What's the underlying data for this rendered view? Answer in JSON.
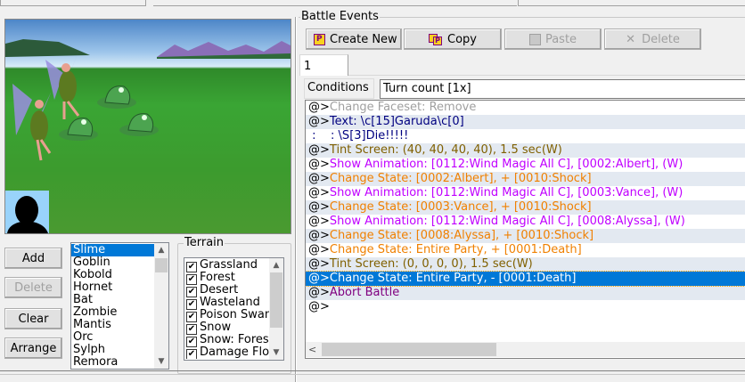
{
  "battle_events": {
    "title": "Battle Events",
    "buttons": {
      "create_new": "Create New",
      "copy": "Copy",
      "paste": "Paste",
      "delete": "Delete"
    },
    "tabs": [
      "1"
    ],
    "conditions_label": "Conditions",
    "conditions_value": "Turn count [1x]",
    "events": [
      {
        "prefix": "@>",
        "text": "Change Faceset: Remove",
        "color": "#a0a0a0"
      },
      {
        "prefix": "@>",
        "text": "Text: \\c[15]Garuda\\c[0]",
        "color": "#000080"
      },
      {
        "prefix": " :",
        "text": "    : \\S[3]Die!!!!!",
        "color": "#000080"
      },
      {
        "prefix": "@>",
        "text": "Tint Screen: (40, 40, 40, 40), 1.5 sec(W)",
        "color": "#806000"
      },
      {
        "prefix": "@>",
        "text": "Show Animation: [0112:Wind Magic All C], [0002:Albert], (W)",
        "color": "#c000ff"
      },
      {
        "prefix": "@>",
        "text": "Change State: [0002:Albert], + [0010:Shock]",
        "color": "#f08000"
      },
      {
        "prefix": "@>",
        "text": "Show Animation: [0112:Wind Magic All C], [0003:Vance], (W)",
        "color": "#c000ff"
      },
      {
        "prefix": "@>",
        "text": "Change State: [0003:Vance], + [0010:Shock]",
        "color": "#f08000"
      },
      {
        "prefix": "@>",
        "text": "Show Animation: [0112:Wind Magic All C], [0008:Alyssa], (W)",
        "color": "#c000ff"
      },
      {
        "prefix": "@>",
        "text": "Change State: [0008:Alyssa], + [0010:Shock]",
        "color": "#f08000"
      },
      {
        "prefix": "@>",
        "text": "Change State: Entire Party, + [0001:Death]",
        "color": "#f08000"
      },
      {
        "prefix": "@>",
        "text": "Tint Screen: (0, 0, 0, 0), 1.5 sec(W)",
        "color": "#806000"
      },
      {
        "prefix": "@>",
        "text": "Change State: Entire Party, - [0001:Death]",
        "color": "#f08000",
        "selected": true
      },
      {
        "prefix": "@>",
        "text": "Abort Battle",
        "color": "#800080"
      },
      {
        "prefix": "@>",
        "text": "",
        "color": "#000000"
      }
    ]
  },
  "troop": {
    "buttons": {
      "add": "Add",
      "delete": "Delete",
      "clear": "Clear",
      "arrange": "Arrange"
    },
    "enemies": [
      "Slime",
      "Goblin",
      "Kobold",
      "Hornet",
      "Bat",
      "Zombie",
      "Mantis",
      "Orc",
      "Sylph",
      "Remora"
    ],
    "selected_enemy": "Slime",
    "terrain_label": "Terrain",
    "terrain": [
      {
        "name": "Grassland",
        "checked": true
      },
      {
        "name": "Forest",
        "checked": true
      },
      {
        "name": "Desert",
        "checked": true
      },
      {
        "name": "Wasteland",
        "checked": true
      },
      {
        "name": "Poison Swamp",
        "checked": true
      },
      {
        "name": "Snow",
        "checked": true
      },
      {
        "name": "Snow: Forest",
        "checked": true
      },
      {
        "name": "Damage Floor",
        "checked": true
      }
    ]
  },
  "colors": {
    "selection": "#0078d7",
    "alt_row": "#e3e9f1"
  }
}
